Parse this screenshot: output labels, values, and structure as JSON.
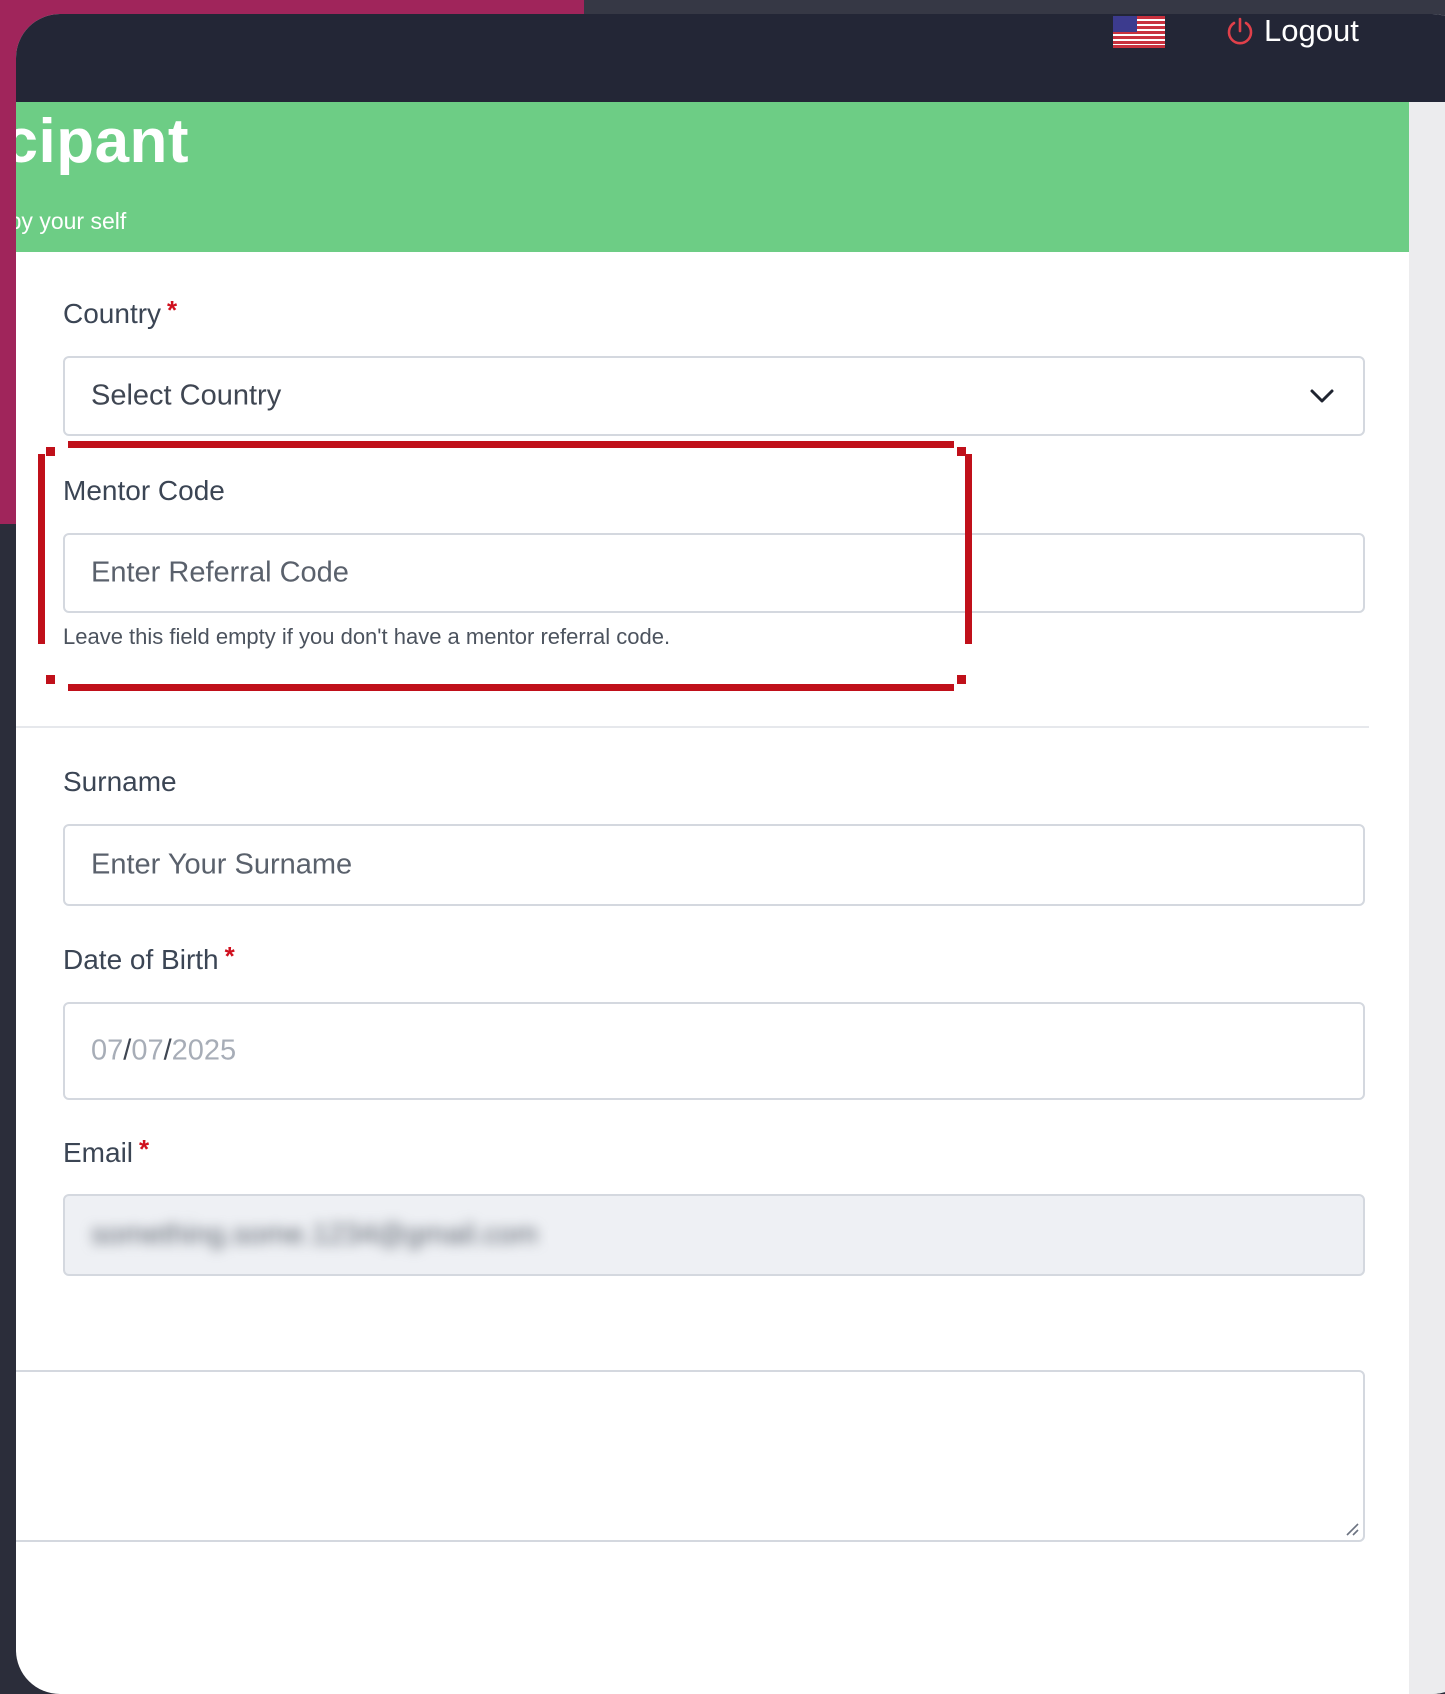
{
  "header": {
    "flag_icon": "us-flag-icon",
    "logout_label": "Logout",
    "logout_icon": "power-icon"
  },
  "banner": {
    "title": "rticipant",
    "subtitle": "gister by your self",
    "color": "#6dcd85"
  },
  "form": {
    "country": {
      "label": "Country",
      "required_mark": "*",
      "selected_value": "Select Country"
    },
    "mentor_code": {
      "label": "Mentor Code",
      "placeholder": "Enter Referral Code",
      "help": "Leave this field empty if you don't have a mentor referral code."
    },
    "surname": {
      "label": "Surname",
      "placeholder": "Enter Your Surname"
    },
    "date_of_birth": {
      "label": "Date of Birth",
      "required_mark": "*",
      "month": "07",
      "day": "07",
      "year": "2025",
      "separator": "/"
    },
    "email": {
      "label": "Email",
      "required_mark": "*",
      "value": "something.some.1234@gmail.com"
    }
  },
  "colors": {
    "required": "#d0101e",
    "highlight_border": "#c0101a",
    "topbar": "#232636",
    "accent_bg": "#a0255b"
  }
}
